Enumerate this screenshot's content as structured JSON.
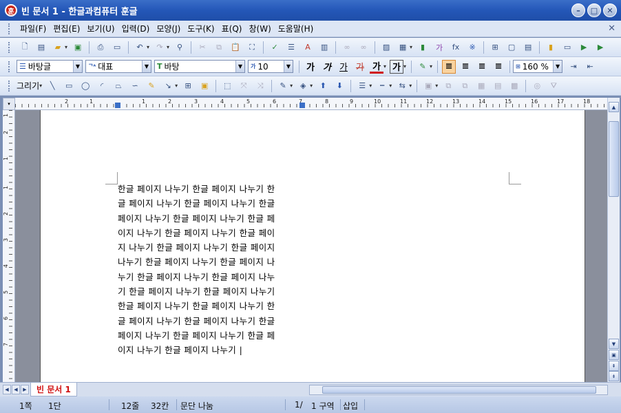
{
  "window": {
    "title": "빈 문서 1 - 한글과컴퓨터 훈글",
    "app_icon": "훈",
    "buttons": [
      "minimize",
      "maximize",
      "close"
    ]
  },
  "menu": [
    "파일(F)",
    "편집(E)",
    "보기(U)",
    "입력(D)",
    "모양(J)",
    "도구(K)",
    "표(Q)",
    "창(W)",
    "도움말(H)"
  ],
  "format_bar": {
    "style": "바탕글",
    "lang": "대표",
    "font": "바탕",
    "size": "10",
    "bold": "가",
    "italic": "가",
    "underline": "가",
    "strike": "가",
    "color": "가",
    "shade": "가",
    "zoom": "160 %"
  },
  "draw_bar": {
    "label": "그리기"
  },
  "ruler": {
    "h_numbers": [
      "2",
      "1",
      "1",
      "2",
      "3",
      "4",
      "5",
      "6",
      "7",
      "8",
      "9",
      "10",
      "11",
      "12",
      "13",
      "14",
      "15",
      "16",
      "17",
      "18"
    ],
    "v_numbers": [
      "1",
      "2",
      "1",
      "1",
      "2",
      "3",
      "4",
      "5",
      "6",
      "7"
    ]
  },
  "document": {
    "lines": [
      "한글 페이지 나누기 한글 페이지 나누기 한",
      "글 페이지 나누기 한글 페이지 나누기 한글",
      "페이지 나누기 한글 페이지 나누기 한글 페",
      "이지 나누기 한글 페이지 나누기 한글 페이",
      "지 나누기 한글 페이지 나누기 한글 페이지",
      "나누기 한글 페이지 나누기 한글 페이지 나",
      "누기 한글 페이지 나누기 한글 페이지 나누",
      "기 한글 페이지 나누기 한글 페이지 나누기",
      "한글 페이지 나누기 한글 페이지 나누기 한",
      "글 페이지 나누기 한글 페이지 나누기 한글",
      "페이지 나누기 한글 페이지 나누기 한글 페",
      "이지 나누기 한글 페이지 나누기 |"
    ]
  },
  "tabs": {
    "active": "빈 문서 1"
  },
  "status": {
    "page": "1쪽",
    "column": "1단",
    "line": "12줄",
    "char": "32칸",
    "paragraph": "문단 나눔",
    "page_of": "1/",
    "section": "1 구역",
    "mode": "삽입"
  }
}
